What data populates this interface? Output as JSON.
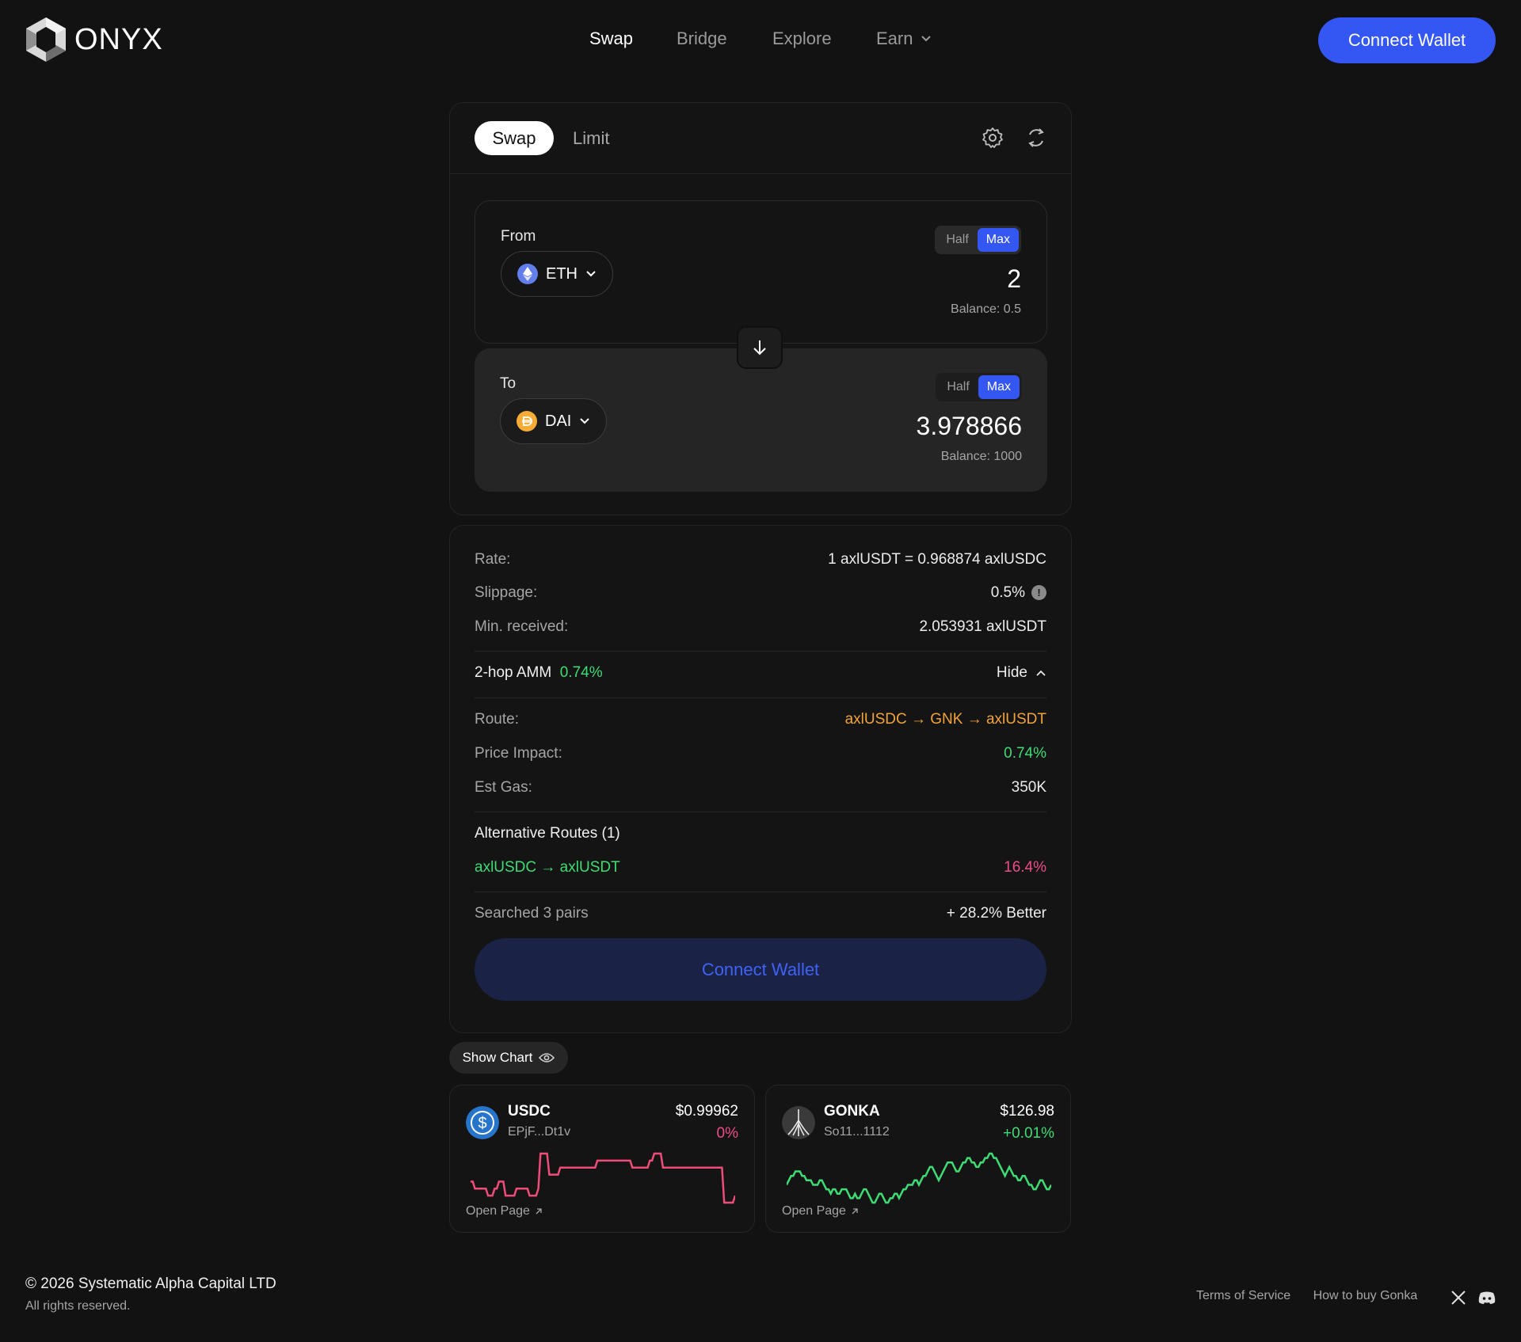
{
  "brand": {
    "name": "ONYX"
  },
  "nav": {
    "swap": "Swap",
    "bridge": "Bridge",
    "explore": "Explore",
    "earn": "Earn"
  },
  "header": {
    "connect_label": "Connect Wallet"
  },
  "swap": {
    "tab_swap": "Swap",
    "tab_limit": "Limit",
    "from": {
      "label": "From",
      "token": "ETH",
      "half": "Half",
      "max": "Max",
      "amount": "2",
      "balance": "Balance: 0.5"
    },
    "to": {
      "label": "To",
      "token": "DAI",
      "half": "Half",
      "max": "Max",
      "amount": "3.978866",
      "balance": "Balance: 1000"
    }
  },
  "details": {
    "rate_label": "Rate:",
    "rate_value": "1 axlUSDT = 0.968874 axlUSDC",
    "slippage_label": "Slippage:",
    "slippage_value": "0.5%",
    "min_label": "Min. received:",
    "min_value": "2.053931 axlUSDT",
    "amm_label": "2-hop AMM",
    "amm_pct": "0.74%",
    "hide_label": "Hide",
    "route_label": "Route:",
    "route_value": "axlUSDC → GNK → axlUSDT",
    "impact_label": "Price Impact:",
    "impact_value": "0.74%",
    "gas_label": "Est Gas:",
    "gas_value": "350K",
    "alt_title": "Alternative Routes (1)",
    "alt_route": "axlUSDC → axlUSDT",
    "alt_pct": "16.4%",
    "searched": "Searched 3 pairs",
    "better": "+ 28.2% Better",
    "connect_label": "Connect Wallet"
  },
  "show_chart_label": "Show Chart",
  "tokens": [
    {
      "name": "USDC",
      "address": "EPjF...Dt1v",
      "price": "$0.99962",
      "change": "0%",
      "open": "Open Page",
      "spark_color": "#ef4c7a",
      "spark": [
        3,
        3,
        2,
        2,
        2,
        2,
        2,
        2,
        1,
        1,
        1,
        2,
        2,
        3,
        3,
        3,
        1,
        1,
        1,
        1,
        1,
        2,
        2,
        2,
        2,
        2,
        2,
        1,
        1,
        1,
        1,
        2,
        7,
        7,
        7,
        7,
        4,
        4,
        4,
        4,
        4,
        5,
        5,
        5,
        5,
        5,
        5,
        5,
        5,
        5,
        5,
        5,
        5,
        5,
        5,
        5,
        5,
        5,
        6,
        6,
        6,
        6,
        6,
        6,
        6,
        6,
        6,
        6,
        6,
        6,
        6,
        6,
        6,
        6,
        5,
        5,
        5,
        5,
        5,
        5,
        5,
        5,
        6,
        6,
        7,
        7,
        7,
        7,
        5,
        5,
        5,
        5,
        5,
        5,
        5,
        5,
        5,
        5,
        5,
        5,
        5,
        5,
        5,
        5,
        5,
        5,
        5,
        5,
        5,
        5,
        5,
        5,
        5,
        5,
        5,
        5,
        0,
        0,
        0,
        0,
        0,
        1
      ]
    },
    {
      "name": "GONKA",
      "address": "So11...1112",
      "price": "$126.98",
      "change": "+0.01%",
      "open": "Open Page",
      "spark_color": "#3ddc74",
      "spark": [
        4,
        5,
        6,
        6,
        7,
        7,
        7,
        6,
        6,
        5,
        5,
        5,
        4,
        4,
        4,
        5,
        5,
        4,
        3,
        3,
        2,
        3,
        3,
        2,
        2,
        3,
        3,
        3,
        2,
        1,
        1,
        2,
        1,
        1,
        2,
        3,
        3,
        2,
        1,
        0,
        0,
        1,
        2,
        2,
        1,
        0,
        0,
        1,
        1,
        2,
        2,
        1,
        2,
        3,
        3,
        4,
        4,
        4,
        5,
        5,
        4,
        5,
        6,
        6,
        7,
        8,
        8,
        7,
        6,
        5,
        6,
        7,
        8,
        9,
        9,
        9,
        8,
        7,
        7,
        8,
        9,
        9,
        10,
        10,
        9,
        9,
        8,
        8,
        9,
        9,
        10,
        10,
        11,
        11,
        10,
        10,
        9,
        8,
        7,
        6,
        7,
        8,
        7,
        6,
        6,
        5,
        5,
        6,
        6,
        5,
        4,
        4,
        3,
        3,
        4,
        5,
        5,
        4,
        3,
        3,
        4
      ]
    }
  ],
  "footer": {
    "copyright": "© 2026 Systematic Alpha Capital LTD",
    "rights": "All rights reserved.",
    "terms": "Terms of Service",
    "howto": "How to buy Gonka"
  }
}
